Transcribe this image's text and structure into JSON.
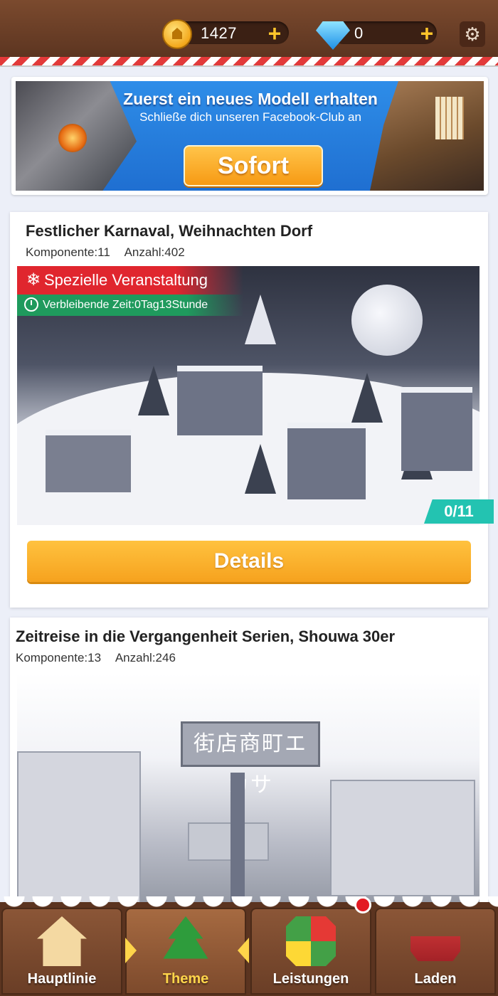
{
  "header": {
    "coins": "1427",
    "gems": "0",
    "plus_label": "+",
    "settings_icon": "gear-icon",
    "coin_icon": "coin-icon",
    "gem_icon": "diamond-icon"
  },
  "banner": {
    "title": "Zuerst ein neues Modell erhalten",
    "subtitle": "Schließe dich unseren Facebook-Club an",
    "button_label": "Sofort",
    "button_color": "#f7a21c",
    "background_color": "#2b86e3"
  },
  "themes": [
    {
      "title": "Festlicher Karnaval, Weihnachten Dorf",
      "components_label": "Komponente:11",
      "count_label": "Anzahl:402",
      "event_label": "Spezielle Veranstaltung",
      "event_icon": "snowflake-icon",
      "time_label": "Verbleibende Zeit:0Tag13Stunde",
      "time_icon": "clock-icon",
      "progress": "0/11",
      "details_label": "Details"
    },
    {
      "title": "Zeitreise in die Vergangenheit Serien, Shouwa 30er",
      "components_label": "Komponente:13",
      "count_label": "Anzahl:246",
      "gate_sign": "街店商町エカサ"
    }
  ],
  "bottom_nav": {
    "tabs": [
      {
        "label": "Hauptlinie",
        "icon": "gingerbread-house-icon"
      },
      {
        "label": "Theme",
        "icon": "christmas-tree-icon",
        "active": true
      },
      {
        "label": "Leistungen",
        "icon": "blocks-icon"
      },
      {
        "label": "Laden",
        "icon": "sleigh-icon"
      }
    ],
    "active_color": "#ffd54a"
  }
}
